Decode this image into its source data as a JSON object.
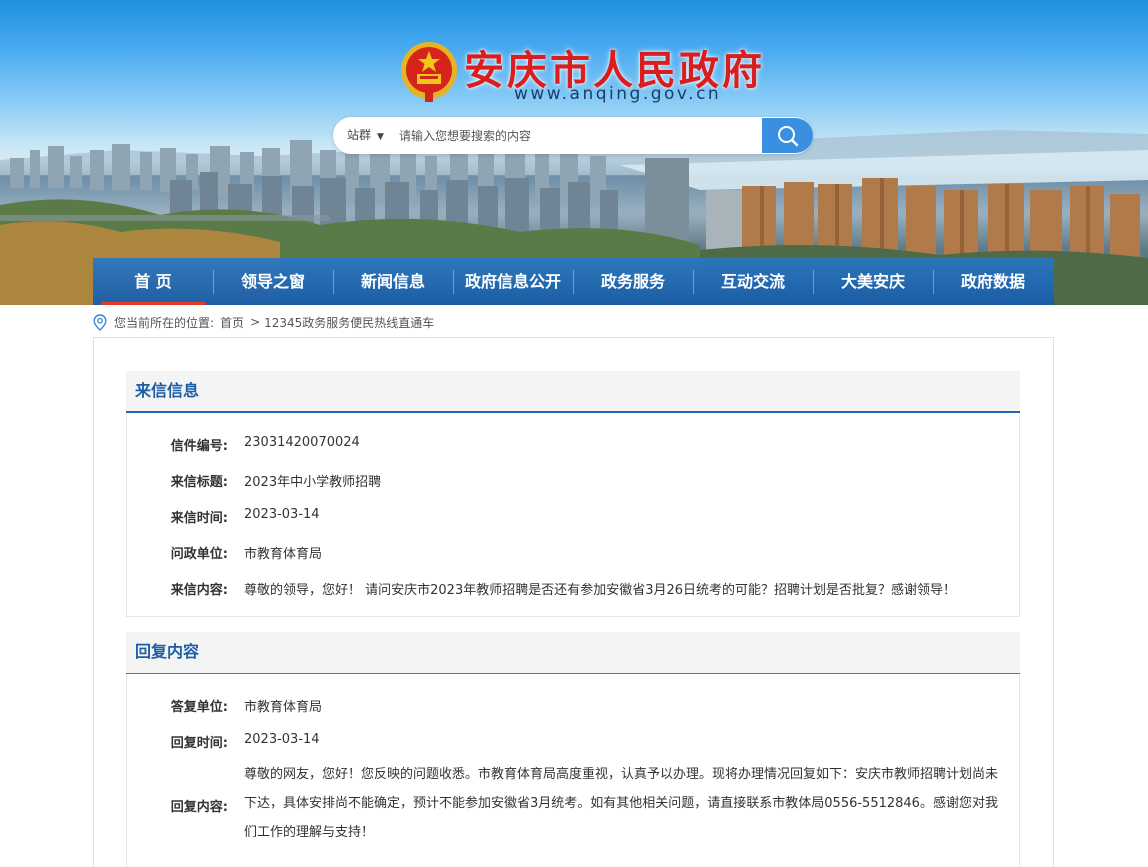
{
  "header": {
    "site_title": "安庆市人民政府",
    "site_url": "www.anqing.gov.cn",
    "emblem_icon": "national-emblem-icon"
  },
  "search": {
    "scope_label": "站群",
    "placeholder": "请输入您想要搜索的内容",
    "button_icon": "search-icon"
  },
  "nav": {
    "items": [
      {
        "label": "首 页"
      },
      {
        "label": "领导之窗"
      },
      {
        "label": "新闻信息"
      },
      {
        "label": "政府信息公开"
      },
      {
        "label": "政务服务"
      },
      {
        "label": "互动交流"
      },
      {
        "label": "大美安庆"
      },
      {
        "label": "政府数据"
      }
    ]
  },
  "breadcrumb": {
    "prefix": "您当前所在的位置:",
    "home": "首页",
    "separator": ">",
    "current": "12345政务服务便民热线直通车"
  },
  "letter": {
    "heading": "来信信息",
    "fields": [
      {
        "label": "信件编号:",
        "value": "23031420070024"
      },
      {
        "label": "来信标题:",
        "value": "2023年中小学教师招聘"
      },
      {
        "label": "来信时间:",
        "value": "2023-03-14"
      },
      {
        "label": "问政单位:",
        "value": "市教育体育局"
      },
      {
        "label": "来信内容:",
        "value": "尊敬的领导，您好！ 请问安庆市2023年教师招聘是否还有参加安徽省3月26日统考的可能？招聘计划是否批复？感谢领导！"
      }
    ]
  },
  "reply": {
    "heading": "回复内容",
    "fields": [
      {
        "label": "答复单位:",
        "value": "市教育体育局"
      },
      {
        "label": "回复时间:",
        "value": "2023-03-14"
      },
      {
        "label": "回复内容:",
        "value": "尊敬的网友，您好！您反映的问题收悉。市教育体育局高度重视，认真予以办理。现将办理情况回复如下：安庆市教师招聘计划尚未下达，具体安排尚不能确定，预计不能参加安徽省3月统考。如有其他相关问题，请直接联系市教体局0556-5512846。感谢您对我们工作的理解与支持！"
      }
    ]
  },
  "colors": {
    "nav_bg": "#2166b3",
    "nav_active": "#e23a2a",
    "title_red": "#d81e1e",
    "heading_blue": "#1c5ea8"
  }
}
